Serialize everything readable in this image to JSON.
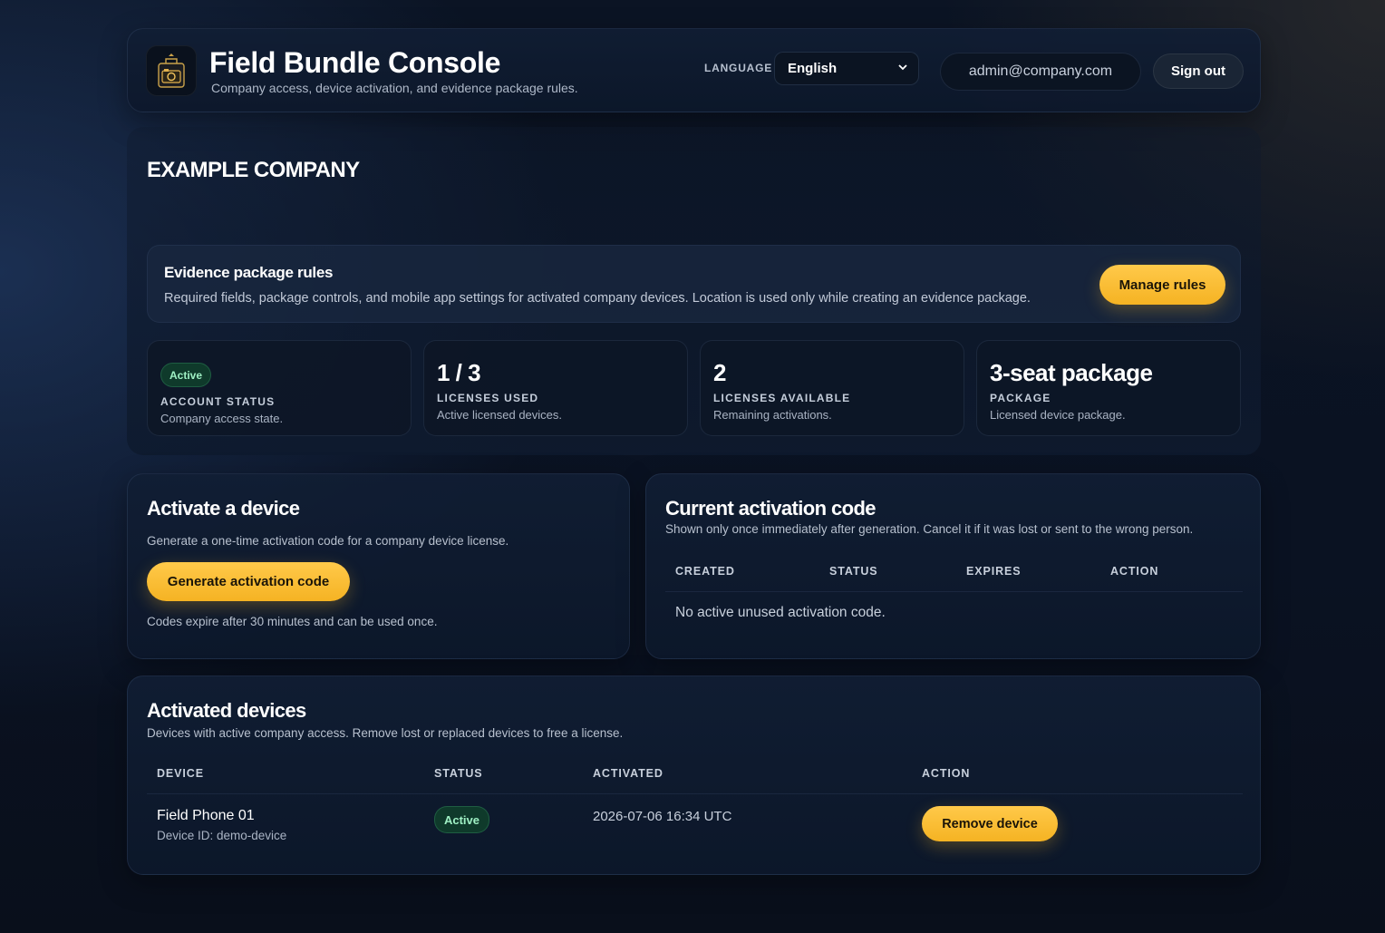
{
  "header": {
    "title": "Field Bundle Console",
    "subtitle": "Company access, device activation, and evidence package rules.",
    "logo_icon": "camera-briefcase-icon",
    "language_label": "LANGUAGE",
    "language_value": "English",
    "email": "admin@company.com",
    "signout_label": "Sign out"
  },
  "company": {
    "name": "EXAMPLE COMPANY",
    "rules": {
      "title": "Evidence package rules",
      "description": "Required fields, package controls, and mobile app settings for activated company devices. Location is used only while creating an evidence package.",
      "button": "Manage rules"
    },
    "stats": [
      {
        "value": "Active",
        "label": "ACCOUNT STATUS",
        "desc": "Company access state."
      },
      {
        "value": "1 / 3",
        "label": "LICENSES USED",
        "desc": "Active licensed devices."
      },
      {
        "value": "2",
        "label": "LICENSES AVAILABLE",
        "desc": "Remaining activations."
      },
      {
        "value": "3-seat package",
        "label": "PACKAGE",
        "desc": "Licensed device package."
      }
    ]
  },
  "activate": {
    "title": "Activate a device",
    "description": "Generate a one-time activation code for a company device license.",
    "button": "Generate activation code",
    "note": "Codes expire after 30 minutes and can be used once."
  },
  "current_code": {
    "title": "Current activation code",
    "description": "Shown only once immediately after generation. Cancel it if it was lost or sent to the wrong person.",
    "columns": [
      "CREATED",
      "STATUS",
      "EXPIRES",
      "ACTION"
    ],
    "empty_message": "No active unused activation code."
  },
  "devices": {
    "title": "Activated devices",
    "description": "Devices with active company access. Remove lost or replaced devices to free a license.",
    "columns": [
      "DEVICE",
      "STATUS",
      "ACTIVATED",
      "ACTION"
    ],
    "rows": [
      {
        "name": "Field Phone 01",
        "device_id": "Device ID: demo-device",
        "status": "Active",
        "activated": "2026-07-06 16:34 UTC",
        "action": "Remove device"
      }
    ]
  },
  "colors": {
    "accent": "#f5b323",
    "active_badge_bg": "#0f3a2b",
    "active_badge_text": "#9ff0c4"
  }
}
